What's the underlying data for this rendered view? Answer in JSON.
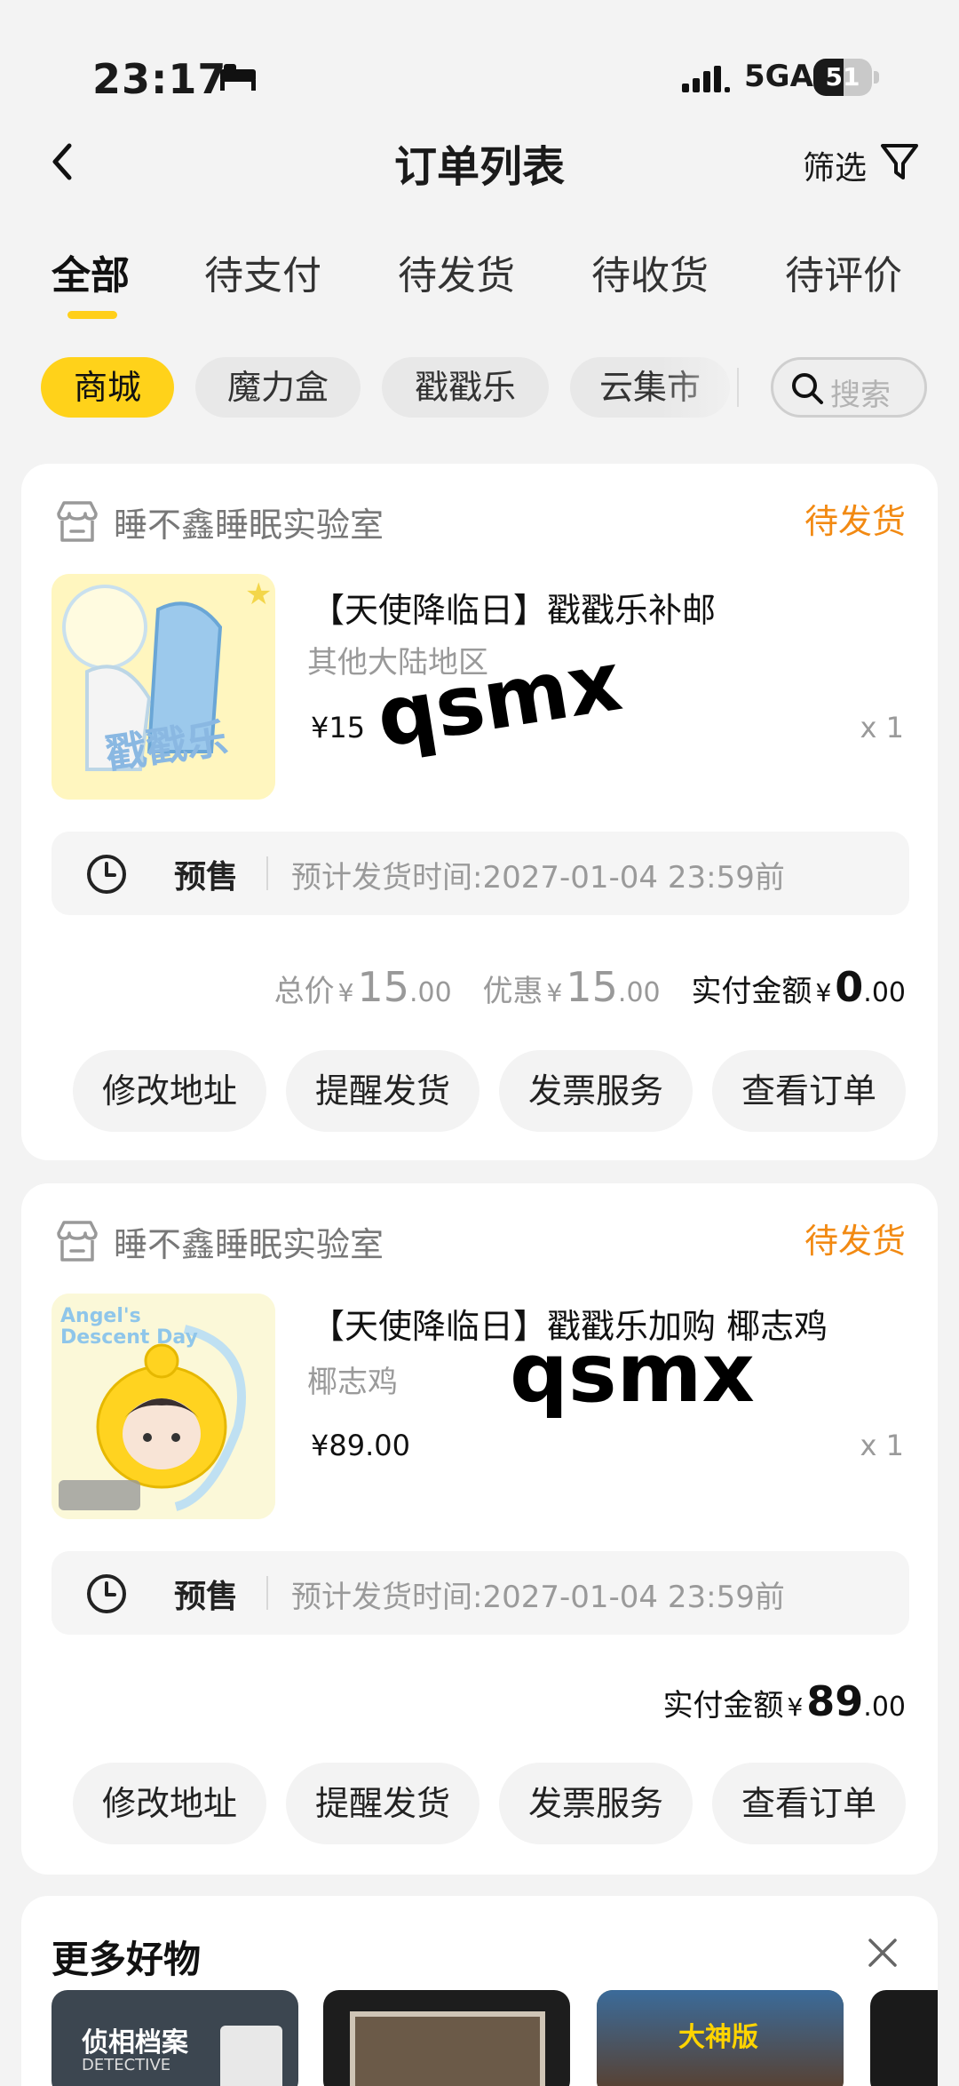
{
  "status_bar": {
    "time": "23:17",
    "network": "5GA",
    "battery": "51",
    "battery_level": 0.51
  },
  "header": {
    "title": "订单列表",
    "filter_label": "筛选"
  },
  "tabs": [
    "全部",
    "待支付",
    "待发货",
    "待收货",
    "待评价"
  ],
  "chips": [
    "商城",
    "魔力盒",
    "戳戳乐",
    "云集市"
  ],
  "search": {
    "placeholder": "搜索"
  },
  "watermark": "qsmx",
  "orders": [
    {
      "shop": "睡不鑫睡眠实验室",
      "status": "待发货",
      "product_name": "【天使降临日】戳戳乐补邮",
      "spec": "其他大陆地区",
      "price": "¥15",
      "qty": "x 1",
      "thumb_text": "戳戳乐",
      "presale_label": "预售",
      "presale_text": "预计发货时间:2027-01-04 23:59前",
      "total_label": "总价",
      "total_int": "15",
      "total_dec": ".00",
      "discount_label": "优惠",
      "discount_int": "15",
      "discount_dec": ".00",
      "paid_label": "实付金额",
      "paid_int": "0",
      "paid_dec": ".00",
      "currency": "¥",
      "buttons": [
        "修改地址",
        "提醒发货",
        "发票服务",
        "查看订单"
      ]
    },
    {
      "shop": "睡不鑫睡眠实验室",
      "status": "待发货",
      "product_name": "【天使降临日】戳戳乐加购 椰志鸡",
      "spec": "椰志鸡",
      "price": "¥89.00",
      "qty": "x 1",
      "thumb_text": "Angel's Descent Day",
      "presale_label": "预售",
      "presale_text": "预计发货时间:2027-01-04 23:59前",
      "paid_label": "实付金额",
      "paid_int": "89",
      "paid_dec": ".00",
      "currency": "¥",
      "buttons": [
        "修改地址",
        "提醒发货",
        "发票服务",
        "查看订单"
      ]
    }
  ],
  "more": {
    "title": "更多好物",
    "item1_text": "侦相档案",
    "item1_sub": "DETECTIVE",
    "item3_text": "大神版"
  }
}
